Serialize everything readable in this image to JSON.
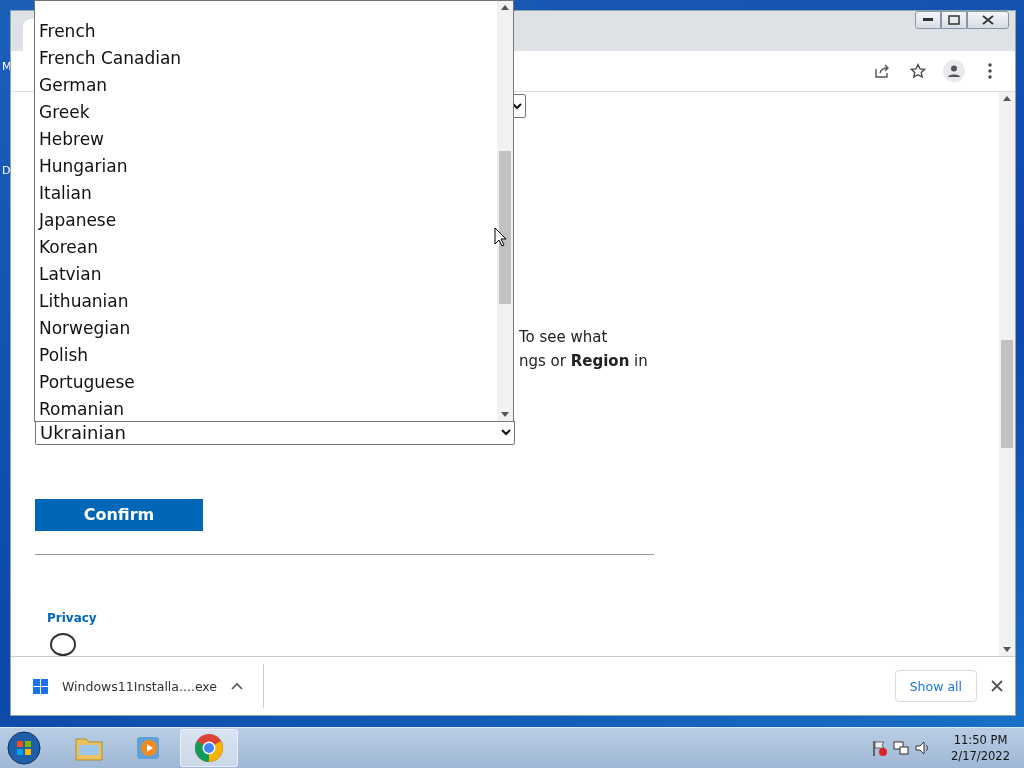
{
  "desktop": {
    "icon_labels": [
      "M",
      "D"
    ]
  },
  "browser": {
    "page": {
      "paragraph_lines": [
        "To see what",
        "ngs or **Region** in"
      ],
      "language_select": {
        "value": "Ukrainian"
      },
      "confirm_button": "Confirm",
      "footer_link": "Privacy"
    },
    "dropdown": {
      "options": [
        "French",
        "French Canadian",
        "German",
        "Greek",
        "Hebrew",
        "Hungarian",
        "Italian",
        "Japanese",
        "Korean",
        "Latvian",
        "Lithuanian",
        "Norwegian",
        "Polish",
        "Portuguese",
        "Romanian"
      ]
    },
    "download_bar": {
      "file": "Windows11Installa....exe",
      "show_all": "Show all"
    }
  },
  "taskbar": {
    "apps": [
      {
        "kind": "explorer",
        "selected": false
      },
      {
        "kind": "media",
        "selected": false
      },
      {
        "kind": "chrome",
        "selected": true
      }
    ],
    "clock": {
      "time": "11:50 PM",
      "date": "2/17/2022"
    }
  }
}
